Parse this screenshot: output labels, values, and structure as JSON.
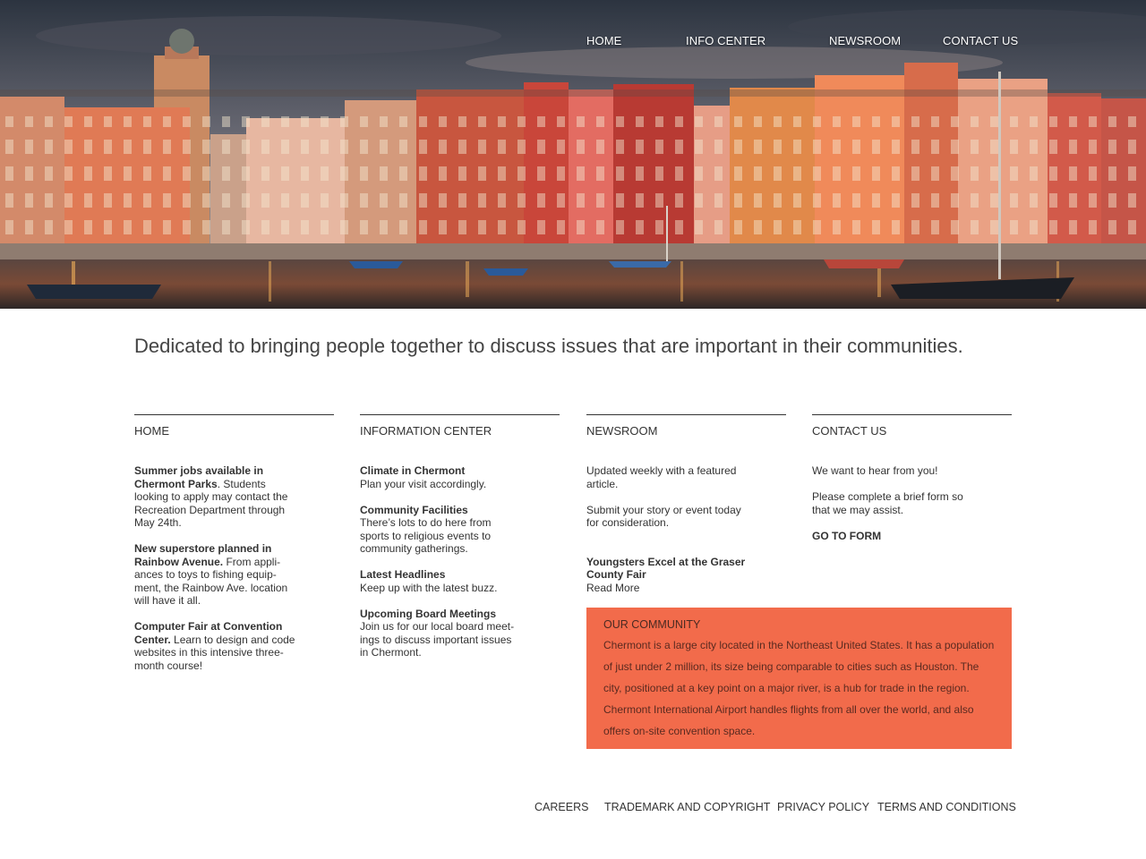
{
  "nav": {
    "home": "HOME",
    "info_center": "INFO CENTER",
    "newsroom": "NEWSROOM",
    "contact": "CONTACT US"
  },
  "tagline": "Dedicated to bringing people together to discuss issues that are important in their communities.",
  "columns": {
    "home": {
      "heading": "HOME",
      "items": [
        {
          "bold": "Summer jobs available in Chermont Parks",
          "text": ". Students looking to apply may contact the Recreation Department through May 24th."
        },
        {
          "bold": "New superstore planned in Rainbow Avenue.",
          "text": " From appli-ances to toys to fishing equip-ment, the Rainbow Ave. location will have it all."
        },
        {
          "bold": "Computer Fair at Convention Center.",
          "text": " Learn to design and code websites in this intensive three-month course!"
        }
      ]
    },
    "info": {
      "heading": "INFORMATION CENTER",
      "items": [
        {
          "bold": "Climate in Chermont",
          "text": "Plan your visit accordingly."
        },
        {
          "bold": "Community Facilities",
          "text": "There’s lots to do here from sports to religious events to community gatherings."
        },
        {
          "bold": "Latest Headlines",
          "text": "Keep up with the latest buzz."
        },
        {
          "bold": "Upcoming Board Meetings",
          "text": "Join us for our local board meet-ings to discuss important issues in Chermont."
        }
      ]
    },
    "news": {
      "heading": "NEWSROOM",
      "p1": "Updated weekly with a featured article.",
      "p2": "Submit your story or event today for consideration.",
      "feature_title": "Youngsters Excel at the Graser County Fair",
      "read_more": "Read More"
    },
    "contact": {
      "heading": "CONTACT US",
      "p1": "We want to hear from you!",
      "p2": "Please complete a brief form so that we may assist.",
      "cta": "GO TO FORM"
    }
  },
  "community": {
    "title": "OUR COMMUNITY",
    "text": "Chermont is a large city located in the Northeast United States. It has a population of just under 2 million, its size being comparable to cities such as Houston. The city, positioned at a key point on a major river, is a hub for trade in the region. Chermont International Airport handles flights from all over the world, and also offers on-site convention space."
  },
  "footer": {
    "careers": "CAREERS",
    "trademark": "TRADEMARK AND COPYRIGHT",
    "privacy": "PRIVACY POLICY",
    "terms": "TERMS AND CONDITIONS"
  },
  "colors": {
    "accent": "#f26b4b",
    "text": "#333333"
  }
}
